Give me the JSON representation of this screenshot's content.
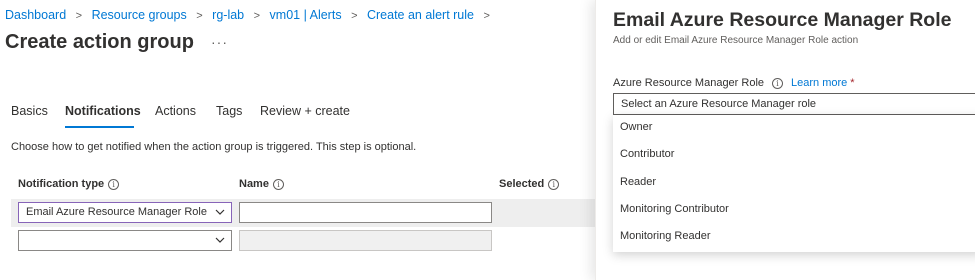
{
  "breadcrumb": {
    "items": [
      "Dashboard",
      "Resource groups",
      "rg-lab",
      "vm01 | Alerts",
      "Create an alert rule"
    ],
    "separator": ">"
  },
  "page": {
    "title": "Create action group",
    "more_label": "···"
  },
  "tabs": [
    {
      "label": "Basics",
      "active": false
    },
    {
      "label": "Notifications",
      "active": true
    },
    {
      "label": "Actions",
      "active": false
    },
    {
      "label": "Tags",
      "active": false
    },
    {
      "label": "Review + create",
      "active": false
    }
  ],
  "notifications": {
    "description": "Choose how to get notified when the action group is triggered. This step is optional.",
    "columns": [
      "Notification type",
      "Name",
      "Selected"
    ],
    "rows": [
      {
        "type": "Email Azure Resource Manager Role",
        "name": ""
      },
      {
        "type": "",
        "name": ""
      }
    ]
  },
  "panel": {
    "title": "Email Azure Resource Manager Role",
    "subtitle": "Add or edit Email Azure Resource Manager Role action",
    "field_label": "Azure Resource Manager Role",
    "learn_more": "Learn more",
    "required_mark": "*",
    "select_placeholder": "Select an Azure Resource Manager role",
    "options": [
      "Owner",
      "Contributor",
      "Reader",
      "Monitoring Contributor",
      "Monitoring Reader"
    ]
  },
  "icons": {
    "info": "info-icon",
    "chevron": "chevron-down-icon",
    "breadcrumb_separator": "chevron-right-icon"
  },
  "colors": {
    "link": "#0078d4",
    "tab_underline": "#0078d4",
    "required": "#a4262c",
    "selected_row_border": "#8764b8"
  }
}
